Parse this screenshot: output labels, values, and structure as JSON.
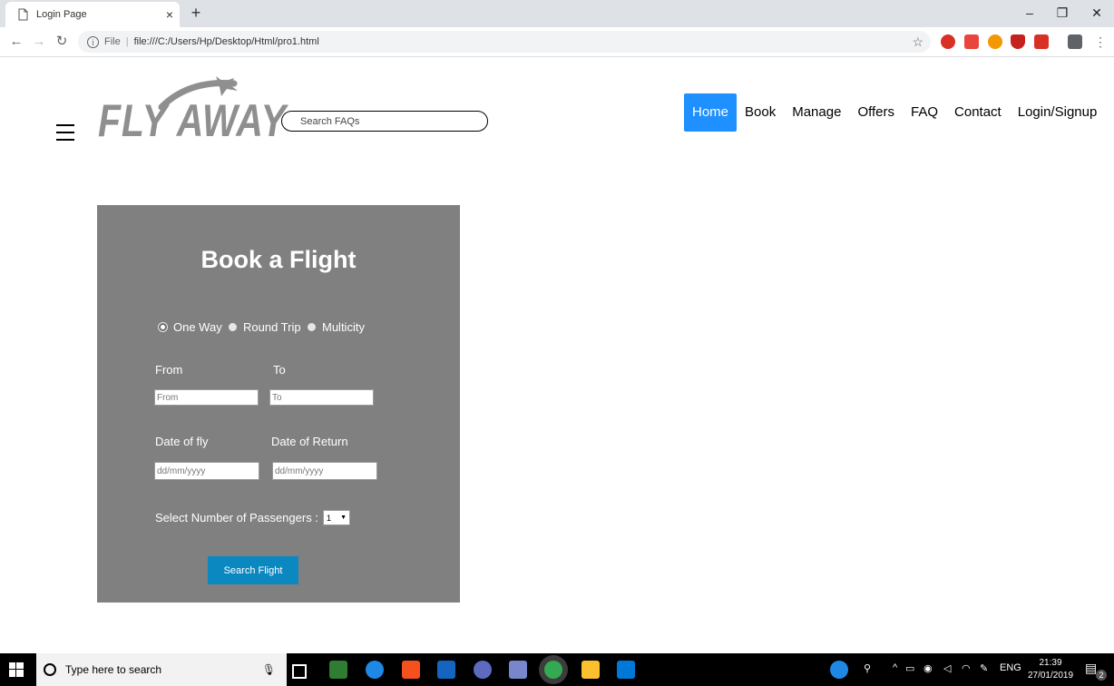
{
  "browser": {
    "tab_title": "Login Page",
    "tab_close": "×",
    "new_tab": "+",
    "address_scheme": "File",
    "address_sep": "|",
    "address_url": "file:///C:/Users/Hp/Desktop/Html/pro1.html",
    "window_minimize": "–",
    "window_maximize": "❐",
    "window_close": "✕",
    "back": "←",
    "forward": "→",
    "reload": "↻",
    "star": "☆",
    "menu": "⋮"
  },
  "header": {
    "logo_text": "FLY AWAY",
    "search_placeholder": "Search FAQs",
    "nav": [
      "Home",
      "Book",
      "Manage",
      "Offers",
      "FAQ",
      "Contact",
      "Login/Signup"
    ]
  },
  "booking": {
    "title": "Book a Flight",
    "trip_types": [
      "One Way",
      "Round Trip",
      "Multicity"
    ],
    "from_label": "From",
    "to_label": "To",
    "from_placeholder": "From",
    "to_placeholder": "To",
    "date_fly_label": "Date of fly",
    "date_return_label": "Date of Return",
    "date_placeholder": "dd/mm/yyyy",
    "passengers_label": "Select Number of Passengers :",
    "passengers_value": "1",
    "search_button": "Search Flight"
  },
  "taskbar": {
    "search_text": "Type here to search",
    "lang": "ENG",
    "time": "21:39",
    "date": "27/01/2019",
    "notifications": "2"
  },
  "colors": {
    "nav_active": "#1e90ff",
    "panel_bg": "#808080",
    "search_button": "#0c88c1",
    "logo": "#8f8f8f"
  }
}
